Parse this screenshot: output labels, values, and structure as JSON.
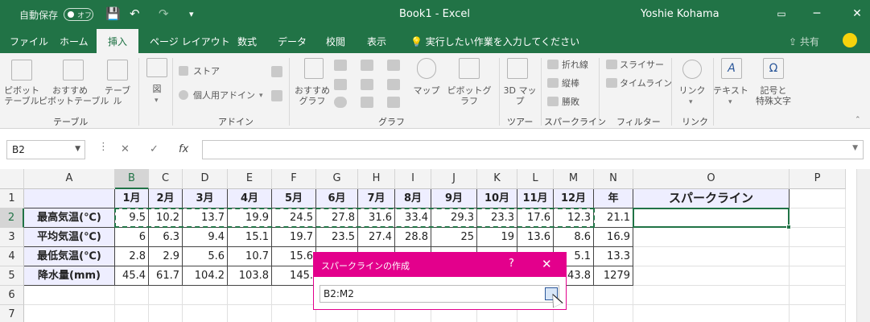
{
  "titlebar": {
    "autosave_label": "自動保存",
    "autosave_state": "オフ",
    "doc_title": "Book1  -  Excel",
    "user": "Yoshie Kohama",
    "minimize": "─",
    "restore": "□",
    "close": "✕",
    "save_icon": "💾",
    "undo_icon": "↶",
    "redo_icon": "↷",
    "customize_icon": "▾"
  },
  "tabs": [
    "ファイル",
    "ホーム",
    "挿入",
    "ページ レイアウト",
    "数式",
    "データ",
    "校閲",
    "表示"
  ],
  "active_tab": "挿入",
  "tellme": "実行したい作業を入力してください",
  "share": "共有",
  "ribbon": {
    "pivot": "ピボット\nテーブル",
    "recommended_pivot": "おすすめ\nピボットテーブル",
    "table": "テーブル",
    "illustrations": "図",
    "store": "ストア",
    "personal_addins": "個人用アドイン",
    "recommended_charts": "おすすめ\nグラフ",
    "map": "マップ",
    "pivot_chart": "ピボットグラフ",
    "map3d": "3D マップ",
    "line": "折れ線",
    "column": "縦棒",
    "winloss": "勝敗",
    "slicer": "スライサー",
    "timeline": "タイムライン",
    "link": "リンク",
    "text": "テキスト",
    "symbols": "記号と\n特殊文字",
    "groups": {
      "tables": "テーブル",
      "addins": "アドイン",
      "charts": "グラフ",
      "tours": "ツアー",
      "sparklines": "スパークライン",
      "filters": "フィルター",
      "links": "リンク"
    }
  },
  "formula_bar": {
    "namebox": "B2",
    "cancel": "✕",
    "enter": "✓",
    "fx": "fx",
    "value": ""
  },
  "columns": [
    "A",
    "B",
    "C",
    "D",
    "E",
    "F",
    "G",
    "H",
    "I",
    "J",
    "K",
    "L",
    "M",
    "N",
    "O",
    "P"
  ],
  "rows": [
    "1",
    "2",
    "3",
    "4",
    "5",
    "6",
    "7"
  ],
  "sheet": {
    "header_row": [
      "",
      "1月",
      "2月",
      "3月",
      "4月",
      "5月",
      "6月",
      "7月",
      "8月",
      "9月",
      "10月",
      "11月",
      "12月",
      "年",
      "スパークライン"
    ],
    "data_rows": [
      [
        "最高気温(℃)",
        "9.5",
        "10.2",
        "13.7",
        "19.9",
        "24.5",
        "27.8",
        "31.6",
        "33.4",
        "29.3",
        "23.3",
        "17.6",
        "12.3",
        "21.1"
      ],
      [
        "平均気温(℃)",
        "6",
        "6.3",
        "9.4",
        "15.1",
        "19.7",
        "23.5",
        "27.4",
        "28.8",
        "25",
        "19",
        "13.6",
        "8.6",
        "16.9"
      ],
      [
        "最低気温(℃)",
        "2.8",
        "2.9",
        "5.6",
        "10.7",
        "15.6",
        "",
        "",
        "",
        "",
        "",
        "",
        "5.1",
        "13.3"
      ],
      [
        "降水量(mm)",
        "45.4",
        "61.7",
        "104.2",
        "103.8",
        "145.",
        "",
        "",
        "",
        "",
        "",
        "",
        "43.8",
        "1279"
      ]
    ]
  },
  "dialog": {
    "title": "スパークラインの作成",
    "help": "?",
    "close": "✕",
    "range_value": "B2:M2"
  },
  "colors": {
    "excel_green": "#217346",
    "dialog_accent": "#e3008c",
    "header_fill": "#eeeeff"
  }
}
